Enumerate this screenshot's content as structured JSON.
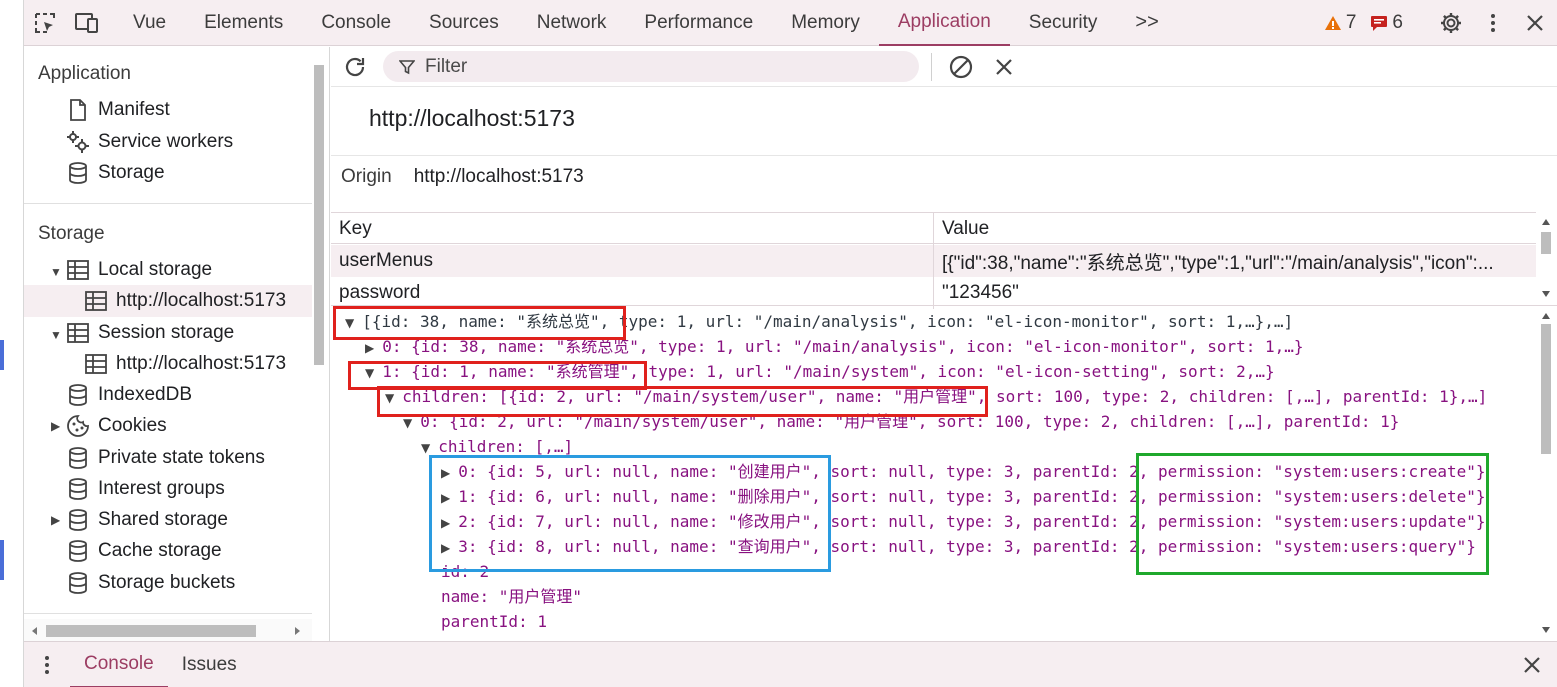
{
  "toolbar": {
    "tabs": [
      "Vue",
      "Elements",
      "Console",
      "Sources",
      "Network",
      "Performance",
      "Memory",
      "Application",
      "Security"
    ],
    "active_tab": "Application",
    "more_label": ">>",
    "warnings_count": "7",
    "messages_count": "6",
    "icons": [
      "inspect-element-icon",
      "device-toolbar-icon",
      "settings-gear-icon",
      "more-options-icon",
      "close-icon"
    ]
  },
  "sidebar": {
    "application_heading": "Application",
    "application_items": [
      {
        "label": "Manifest",
        "icon": "file-icon"
      },
      {
        "label": "Service workers",
        "icon": "gears-icon"
      },
      {
        "label": "Storage",
        "icon": "database-icon"
      }
    ],
    "storage_heading": "Storage",
    "storage_items": [
      {
        "label": "Local storage",
        "icon": "table-icon",
        "expanded": true
      },
      {
        "label": "http://localhost:5173",
        "icon": "table-icon",
        "selected": true
      },
      {
        "label": "Session storage",
        "icon": "table-icon",
        "expanded": true
      },
      {
        "label": "http://localhost:5173",
        "icon": "table-icon"
      },
      {
        "label": "IndexedDB",
        "icon": "database-icon"
      },
      {
        "label": "Cookies",
        "icon": "cookie-icon",
        "collapsed": true
      },
      {
        "label": "Private state tokens",
        "icon": "database-icon"
      },
      {
        "label": "Interest groups",
        "icon": "database-icon"
      },
      {
        "label": "Shared storage",
        "icon": "database-icon",
        "collapsed": true
      },
      {
        "label": "Cache storage",
        "icon": "database-icon"
      },
      {
        "label": "Storage buckets",
        "icon": "database-icon"
      }
    ]
  },
  "main": {
    "filter_placeholder": "Filter",
    "origin_title": "http://localhost:5173",
    "origin_label": "Origin",
    "origin_value": "http://localhost:5173",
    "table": {
      "headers": [
        "Key",
        "Value"
      ],
      "rows": [
        {
          "key": "userMenus",
          "value": "[{\"id\":38,\"name\":\"系统总览\",\"type\":1,\"url\":\"/main/analysis\",\"icon\":..."
        },
        {
          "key": "password",
          "value": "\"123456\""
        }
      ]
    },
    "preview_lines": [
      "[{id: 38, name: \"系统总览\", type: 1, url: \"/main/analysis\", icon: \"el-icon-monitor\", sort: 1,…},…]",
      "0: {id: 38, name: \"系统总览\", type: 1, url: \"/main/analysis\", icon: \"el-icon-monitor\", sort: 1,…}",
      "1: {id: 1, name: \"系统管理\", type: 1, url: \"/main/system\", icon: \"el-icon-setting\", sort: 2,…}",
      "children: [{id: 2, url: \"/main/system/user\", name: \"用户管理\", sort: 100, type: 2, children: [,…], parentId: 1},…]",
      "0: {id: 2, url: \"/main/system/user\", name: \"用户管理\", sort: 100, type: 2, children: [,…], parentId: 1}",
      "children: [,…]",
      "0: {id: 5, url: null, name: \"创建用户\", sort: null, type: 3, parentId: 2, permission: \"system:users:create\"}",
      "1: {id: 6, url: null, name: \"删除用户\", sort: null, type: 3, parentId: 2, permission: \"system:users:delete\"}",
      "2: {id: 7, url: null, name: \"修改用户\", sort: null, type: 3, parentId: 2, permission: \"system:users:update\"}",
      "3: {id: 8, url: null, name: \"查询用户\", sort: null, type: 3, parentId: 2, permission: \"system:users:query\"}",
      "id: 2",
      "name: \"用户管理\"",
      "parentId: 1"
    ],
    "highlight_colors": {
      "red": "#e0211d",
      "blue": "#2a9be0",
      "green": "#1fa82c"
    }
  },
  "drawer": {
    "tabs": [
      "Console",
      "Issues"
    ],
    "active_tab": "Console"
  },
  "colors": {
    "accent": "#9c3d63",
    "toolbar_bg": "#f6eef1",
    "warning": "#e8710a"
  }
}
